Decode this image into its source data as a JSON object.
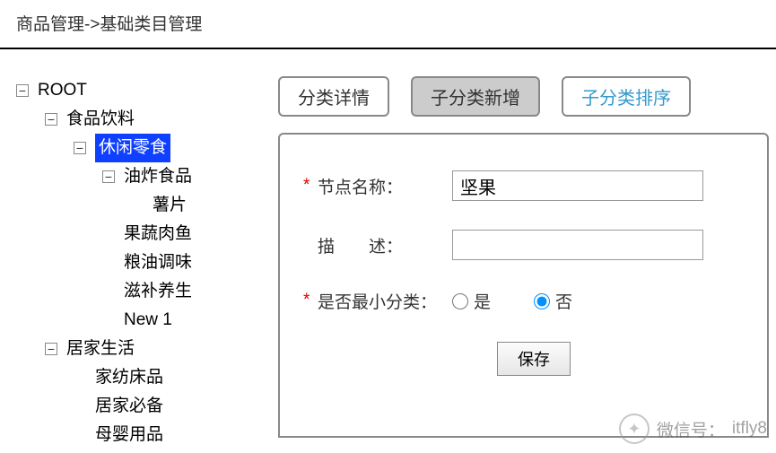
{
  "breadcrumb": "商品管理->基础类目管理",
  "tree": {
    "root": "ROOT",
    "l1": "食品饮料",
    "l2_selected": "休闲零食",
    "l3": "油炸食品",
    "l4": "薯片",
    "siblings": [
      "果蔬肉鱼",
      "粮油调味",
      "滋补养生",
      "New 1"
    ],
    "l1b": "居家生活",
    "l1b_children": [
      "家纺床品",
      "居家必备",
      "母婴用品"
    ]
  },
  "tabs": {
    "detail": "分类详情",
    "add": "子分类新增",
    "sort": "子分类排序"
  },
  "form": {
    "node_name_label": "节点名称：",
    "node_name_value": "坚果",
    "desc_label": "描　　述：",
    "desc_value": "",
    "min_label": "是否最小分类：",
    "yes": "是",
    "no": "否",
    "min_value": "no",
    "save": "保存"
  },
  "watermark": {
    "prefix": "微信号：",
    "value": "itfly8"
  },
  "glyphs": {
    "minus": "−",
    "plus": "+"
  }
}
